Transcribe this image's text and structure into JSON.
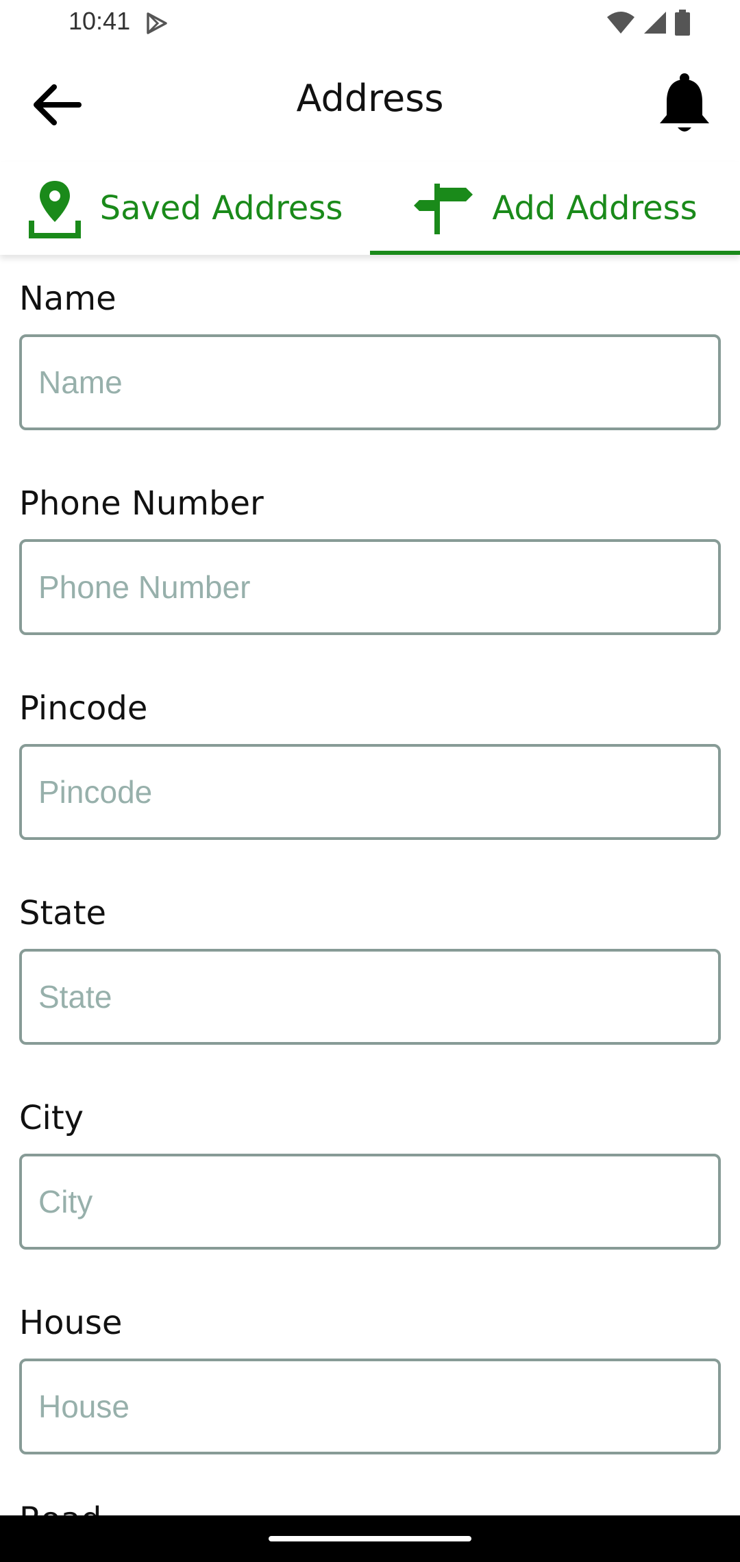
{
  "status_bar": {
    "time": "10:41",
    "icons": [
      "play-store-icon",
      "wifi-icon",
      "signal-icon",
      "battery-icon"
    ]
  },
  "app_bar": {
    "title": "Address",
    "back_icon": "arrow-left-icon",
    "notification_icon": "bell-icon"
  },
  "tabs": [
    {
      "label": "Saved Address",
      "icon": "map-pin-icon",
      "active": false
    },
    {
      "label": "Add Address",
      "icon": "signpost-icon",
      "active": true
    }
  ],
  "form": {
    "fields": [
      {
        "label": "Name",
        "placeholder": "Name",
        "value": ""
      },
      {
        "label": "Phone Number",
        "placeholder": "Phone Number",
        "value": ""
      },
      {
        "label": "Pincode",
        "placeholder": "Pincode",
        "value": ""
      },
      {
        "label": "State",
        "placeholder": "State",
        "value": ""
      },
      {
        "label": "City",
        "placeholder": "City",
        "value": ""
      },
      {
        "label": "House",
        "placeholder": "House",
        "value": ""
      }
    ],
    "next_label_partial": "Road"
  },
  "colors": {
    "accent": "#1a8a1a",
    "input_border": "#879b96",
    "placeholder": "#97b0ab"
  }
}
